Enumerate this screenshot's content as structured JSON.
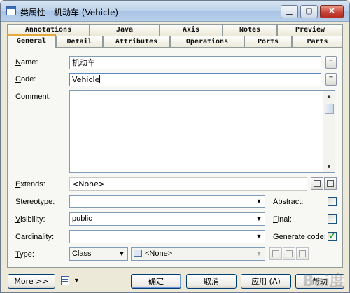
{
  "window": {
    "title": "类属性 - 机动车 (Vehicle)"
  },
  "tabs_top": [
    "Annotations",
    "Java",
    "Axis",
    "Notes",
    "Preview"
  ],
  "tabs_bottom": [
    "General",
    "Detail",
    "Attributes",
    "Operations",
    "Ports",
    "Parts"
  ],
  "active_tab": "General",
  "fields": {
    "name": {
      "label_pre": "",
      "label_key": "N",
      "label_post": "ame:",
      "value": "机动车"
    },
    "code": {
      "label_pre": "",
      "label_key": "C",
      "label_post": "ode:",
      "value": "Vehicle"
    },
    "comment": {
      "label_pre": "C",
      "label_key": "o",
      "label_post": "mment:",
      "value": ""
    },
    "extends": {
      "label_pre": "",
      "label_key": "E",
      "label_post": "xtends:",
      "value": "<None>"
    },
    "stereotype": {
      "label_pre": "",
      "label_key": "S",
      "label_post": "tereotype:",
      "value": ""
    },
    "visibility": {
      "label_pre": "",
      "label_key": "V",
      "label_post": "isibility:",
      "value": "public"
    },
    "cardinality": {
      "label_pre": "C",
      "label_key": "a",
      "label_post": "rdinality:",
      "value": ""
    },
    "type": {
      "label_pre": "",
      "label_key": "T",
      "label_post": "ype:",
      "value": "Class",
      "ref_value": "<None>"
    }
  },
  "checkboxes": {
    "abstract": {
      "label_pre": "",
      "label_key": "A",
      "label_post": "bstract:",
      "checked": false
    },
    "final": {
      "label_pre": "",
      "label_key": "F",
      "label_post": "inal:",
      "checked": false
    },
    "generate_code": {
      "label_pre": "",
      "label_key": "G",
      "label_post": "enerate code:",
      "checked": true
    }
  },
  "equal_button_label": "=",
  "buttons": {
    "more": "More >>",
    "ok": "确定",
    "cancel": "取消",
    "apply": "应用 (A)",
    "help": "帮助"
  },
  "watermark": "Bai度"
}
